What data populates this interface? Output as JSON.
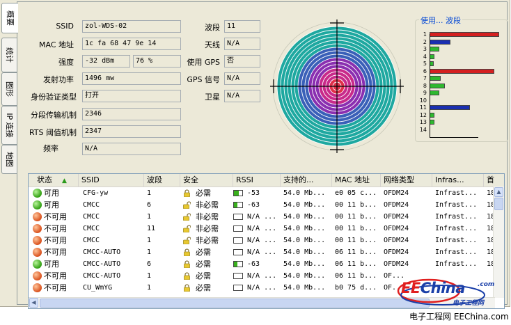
{
  "tabs": [
    {
      "label": "概要",
      "active": true
    },
    {
      "label": "统计",
      "active": false
    },
    {
      "label": "图形",
      "active": false
    },
    {
      "label": "IP 连接",
      "active": false
    },
    {
      "label": "地图",
      "active": false
    }
  ],
  "details": {
    "ssid_label": "SSID",
    "ssid_value": "zol-WDS-02",
    "mac_label": "MAC 地址",
    "mac_value": "1c fa 68 47 9e 14",
    "strength_label": "强度",
    "strength_dbm": "-32 dBm",
    "strength_pct": "76 %",
    "txpower_label": "发射功率",
    "txpower_value": "1496 mw",
    "auth_label": "身份验证类型",
    "auth_value": "打开",
    "frag_label": "分段传输机制",
    "frag_value": "2346",
    "rts_label": "RTS 阈值机制",
    "rts_value": "2347",
    "freq_label": "频率",
    "freq_value": "N/A",
    "channel_label": "波段",
    "channel_value": "11",
    "antenna_label": "天线",
    "antenna_value": "N/A",
    "gps_use_label": "使用 GPS",
    "gps_use_value": "否",
    "gps_signal_label": "GPS 信号",
    "gps_signal_value": "N/A",
    "satellite_label": "卫星",
    "satellite_value": "N/A"
  },
  "channel_usage": {
    "title": "使用... 波段",
    "channels": [
      {
        "ch": "1",
        "level": 1.0,
        "color": "#d42020"
      },
      {
        "ch": "2",
        "level": 0.3,
        "color": "#1a2fb0"
      },
      {
        "ch": "3",
        "level": 0.14,
        "color": "#2fb82f"
      },
      {
        "ch": "4",
        "level": 0.07,
        "color": "#2fb82f"
      },
      {
        "ch": "5",
        "level": 0.05,
        "color": "#2fb82f"
      },
      {
        "ch": "6",
        "level": 0.93,
        "color": "#d42020"
      },
      {
        "ch": "7",
        "level": 0.16,
        "color": "#2fb82f"
      },
      {
        "ch": "8",
        "level": 0.22,
        "color": "#2fb82f"
      },
      {
        "ch": "9",
        "level": 0.14,
        "color": "#2fb82f"
      },
      {
        "ch": "10",
        "level": 0.0,
        "color": "#2fb82f"
      },
      {
        "ch": "11",
        "level": 0.58,
        "color": "#1a2fb0"
      },
      {
        "ch": "12",
        "level": 0.07,
        "color": "#2fb82f"
      },
      {
        "ch": "13",
        "level": 0.07,
        "color": "#2fb82f"
      },
      {
        "ch": "14",
        "level": 0.0,
        "color": "#2fb82f"
      }
    ]
  },
  "network_list": {
    "columns": [
      "状态",
      "SSID",
      "波段",
      "安全",
      "RSSI",
      "支持的...",
      "MAC 地址",
      "网络类型",
      "Infras...",
      "首"
    ],
    "rows": [
      {
        "status": "可用",
        "status_color": "green",
        "ssid": "CFG-yw",
        "channel": "1",
        "security": "必需",
        "rssi": "-53",
        "rssi_level": 0.6,
        "rate": "54.0 Mb...",
        "mac": "e0 05 c...",
        "type": "OFDM24",
        "infra": "Infrast...",
        "first": "18"
      },
      {
        "status": "可用",
        "status_color": "green",
        "ssid": "CMCC",
        "channel": "6",
        "security": "非必需",
        "rssi": "-63",
        "rssi_level": 0.4,
        "rate": "54.0 Mb...",
        "mac": "00 11 b...",
        "type": "OFDM24",
        "infra": "Infrast...",
        "first": "18"
      },
      {
        "status": "不可用",
        "status_color": "red",
        "ssid": "CMCC",
        "channel": "1",
        "security": "非必需",
        "rssi": "N/A ...",
        "rssi_level": 0,
        "rate": "54.0 Mb...",
        "mac": "00 11 b...",
        "type": "OFDM24",
        "infra": "Infrast...",
        "first": "18"
      },
      {
        "status": "不可用",
        "status_color": "red",
        "ssid": "CMCC",
        "channel": "11",
        "security": "非必需",
        "rssi": "N/A ...",
        "rssi_level": 0,
        "rate": "54.0 Mb...",
        "mac": "00 11 b...",
        "type": "OFDM24",
        "infra": "Infrast...",
        "first": "18"
      },
      {
        "status": "不可用",
        "status_color": "red",
        "ssid": "CMCC",
        "channel": "1",
        "security": "非必需",
        "rssi": "N/A ...",
        "rssi_level": 0,
        "rate": "54.0 Mb...",
        "mac": "00 11 b...",
        "type": "OFDM24",
        "infra": "Infrast...",
        "first": "18"
      },
      {
        "status": "不可用",
        "status_color": "red",
        "ssid": "CMCC-AUTO",
        "channel": "1",
        "security": "必需",
        "rssi": "N/A ...",
        "rssi_level": 0,
        "rate": "54.0 Mb...",
        "mac": "06 11 b...",
        "type": "OFDM24",
        "infra": "Infrast...",
        "first": "18"
      },
      {
        "status": "可用",
        "status_color": "green",
        "ssid": "CMCC-AUTO",
        "channel": "6",
        "security": "必需",
        "rssi": "-63",
        "rssi_level": 0.4,
        "rate": "54.0 Mb...",
        "mac": "06 11 b...",
        "type": "OFDM24",
        "infra": "Infrast...",
        "first": "18"
      },
      {
        "status": "不可用",
        "status_color": "red",
        "ssid": "CMCC-AUTO",
        "channel": "1",
        "security": "必需",
        "rssi": "N/A ...",
        "rssi_level": 0,
        "rate": "54.0 Mb...",
        "mac": "06 11 b...",
        "type": "OF...",
        "infra": "",
        "first": ""
      },
      {
        "status": "不可用",
        "status_color": "red",
        "ssid": "CU_WmYG",
        "channel": "1",
        "security": "必需",
        "rssi": "N/A ...",
        "rssi_level": 0,
        "rate": "54.0 Mb...",
        "mac": "b0 75 d...",
        "type": "OF...",
        "infra": "",
        "first": ""
      }
    ]
  },
  "watermark": {
    "brand_ee": "EE",
    "brand_china": "China",
    "brand_com": ".com",
    "subtitle": "电子工程网"
  },
  "caption": "电子工程网  EEChina.com"
}
